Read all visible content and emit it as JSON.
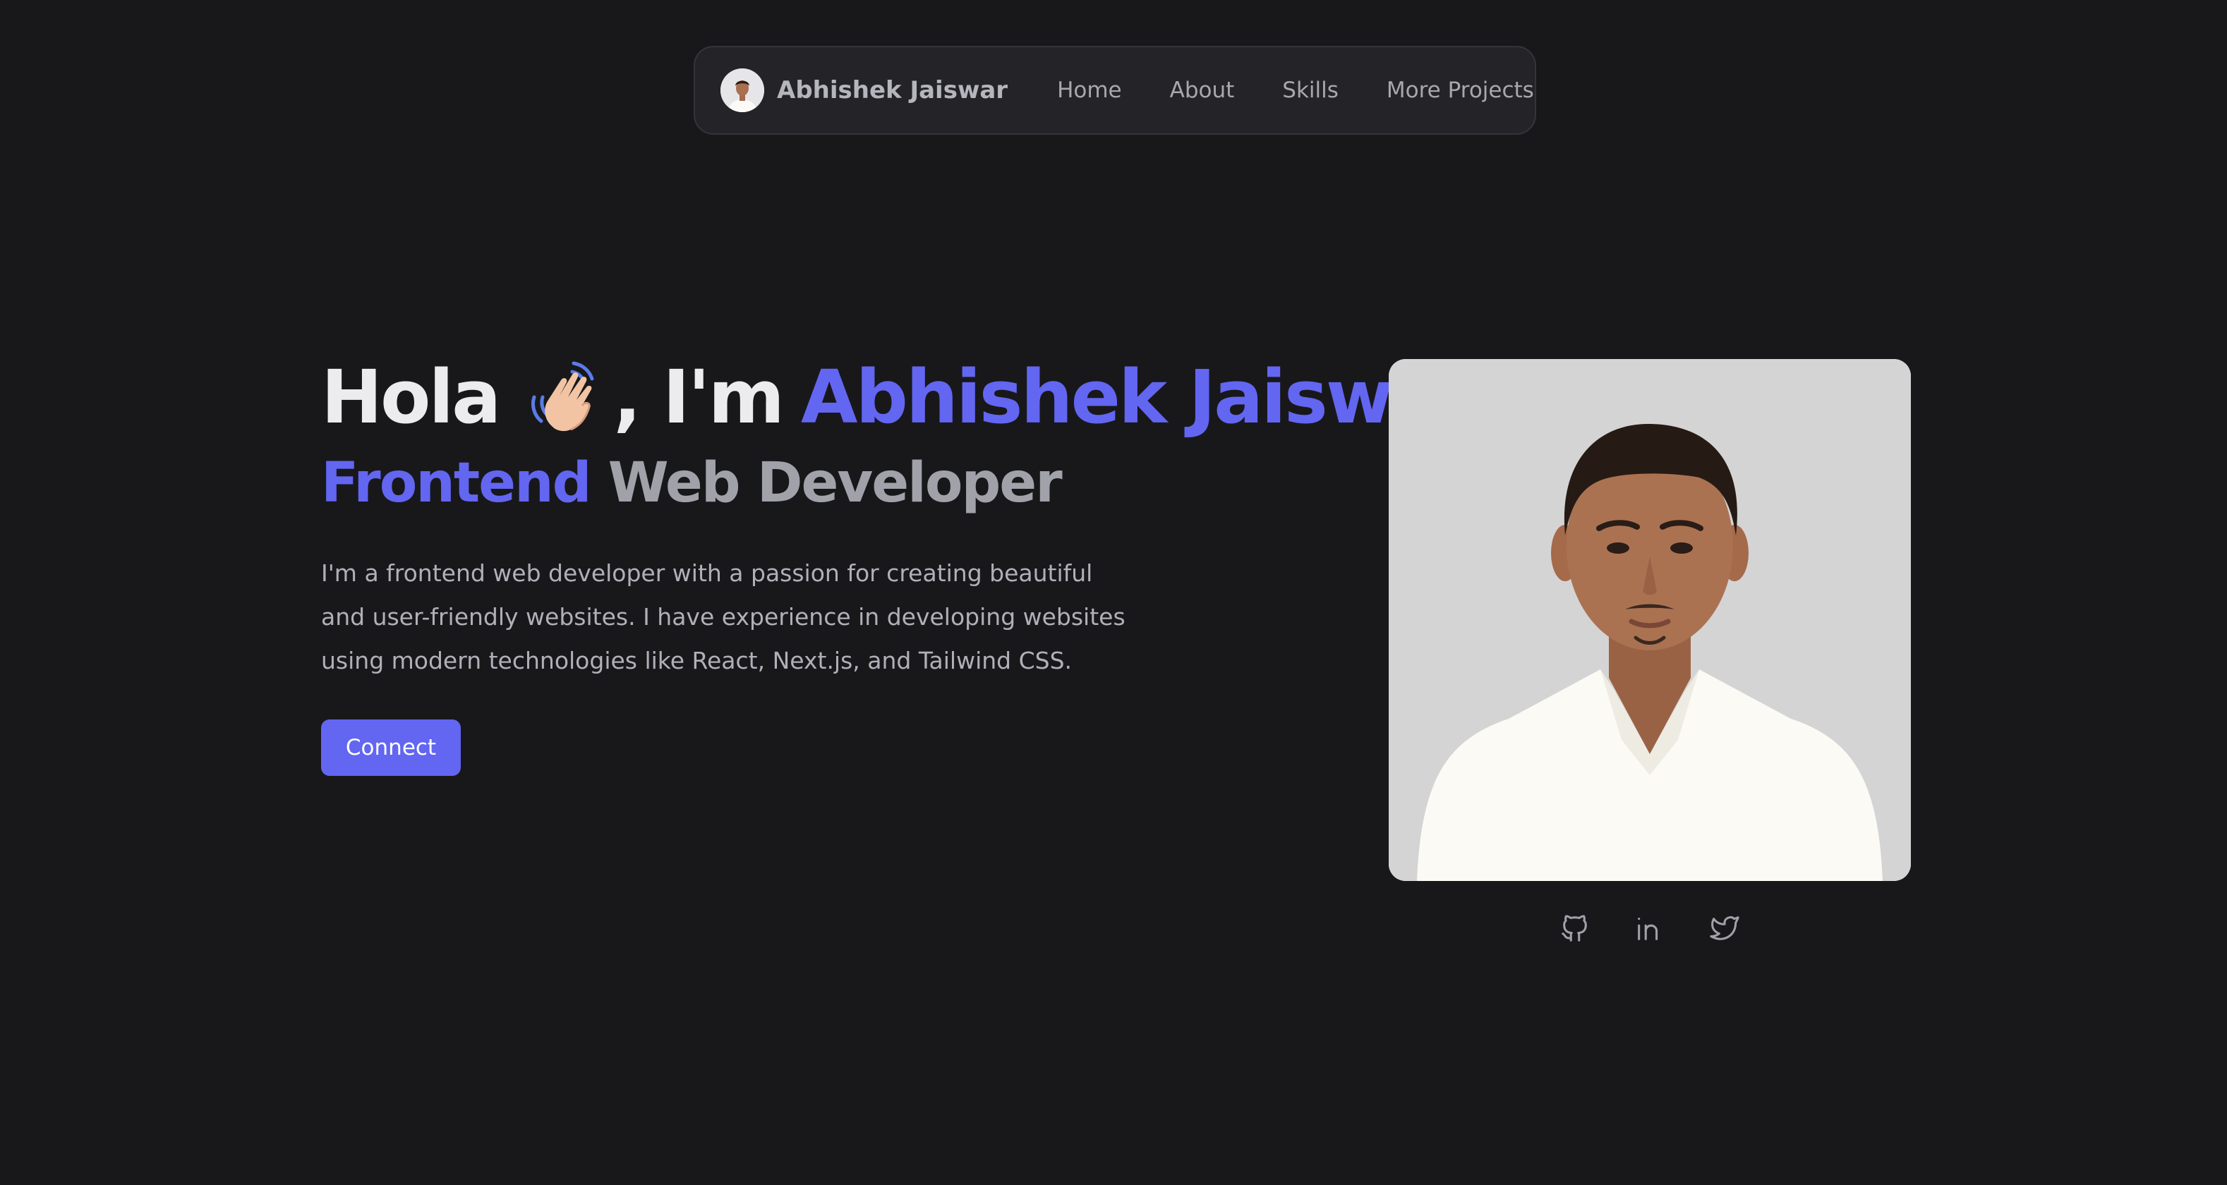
{
  "navbar": {
    "brand_name": "Abhishek Jaiswar",
    "links": [
      "Home",
      "About",
      "Skills",
      "More Projects"
    ]
  },
  "hero": {
    "greeting": "Hola",
    "greeting_suffix": ", I'm",
    "name": "Abhishek Jaiswar",
    "role_accent": "Frontend",
    "role_rest": "Web Developer",
    "description": "I'm a frontend web developer with a passion for creating beautiful and user-friendly websites. I have experience in developing websites using modern technologies like React, Next.js, and Tailwind CSS.",
    "cta_label": "Connect"
  },
  "icons": {
    "wave": "waving-hand-icon",
    "social": [
      "github-icon",
      "linkedin-icon",
      "twitter-icon"
    ]
  },
  "colors": {
    "background": "#18181b",
    "accent": "#6366f1",
    "nav_bg": "#242428",
    "text": "#ececef",
    "muted": "#a1a1aa"
  }
}
